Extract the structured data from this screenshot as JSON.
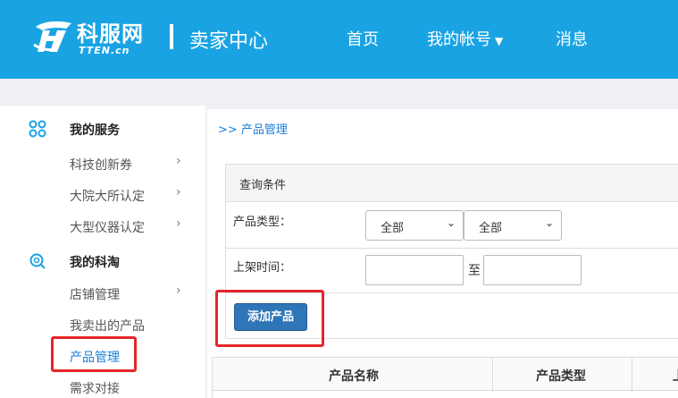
{
  "header": {
    "logo_text": "科服网",
    "logo_sub": "TTEN.cn",
    "title": "卖家中心",
    "nav": {
      "home": "首页",
      "account": "我的帐号",
      "account_caret": "▼",
      "messages": "消息"
    }
  },
  "sidebar": {
    "sections": [
      {
        "label": "我的服务",
        "icon": "grid-icon",
        "items": [
          {
            "label": "科技创新券",
            "has_chevron": true
          },
          {
            "label": "大院大所认定",
            "has_chevron": true
          },
          {
            "label": "大型仪器认定",
            "has_chevron": true
          }
        ]
      },
      {
        "label": "我的科淘",
        "icon": "search-globe-icon",
        "items": [
          {
            "label": "店铺管理",
            "has_chevron": true
          },
          {
            "label": "我卖出的产品",
            "has_chevron": false
          },
          {
            "label": "产品管理",
            "has_chevron": false,
            "active": true
          },
          {
            "label": "需求对接",
            "has_chevron": false
          }
        ]
      }
    ],
    "chevron": "›"
  },
  "main": {
    "breadcrumb": ">> 产品管理",
    "query": {
      "title": "查询条件",
      "type_label": "产品类型：",
      "type_select_1": "全部",
      "type_select_2": "全部",
      "time_label": "上架时间：",
      "time_from": "",
      "time_to": "",
      "to_label": "至"
    },
    "add_button": "添加产品",
    "table": {
      "columns": [
        "产品名称",
        "产品类型",
        "上"
      ]
    }
  },
  "colors": {
    "header_bg": "#1aa3e3",
    "accent": "#1a7fd8",
    "button": "#2f76b8",
    "highlight": "#e5252b"
  }
}
